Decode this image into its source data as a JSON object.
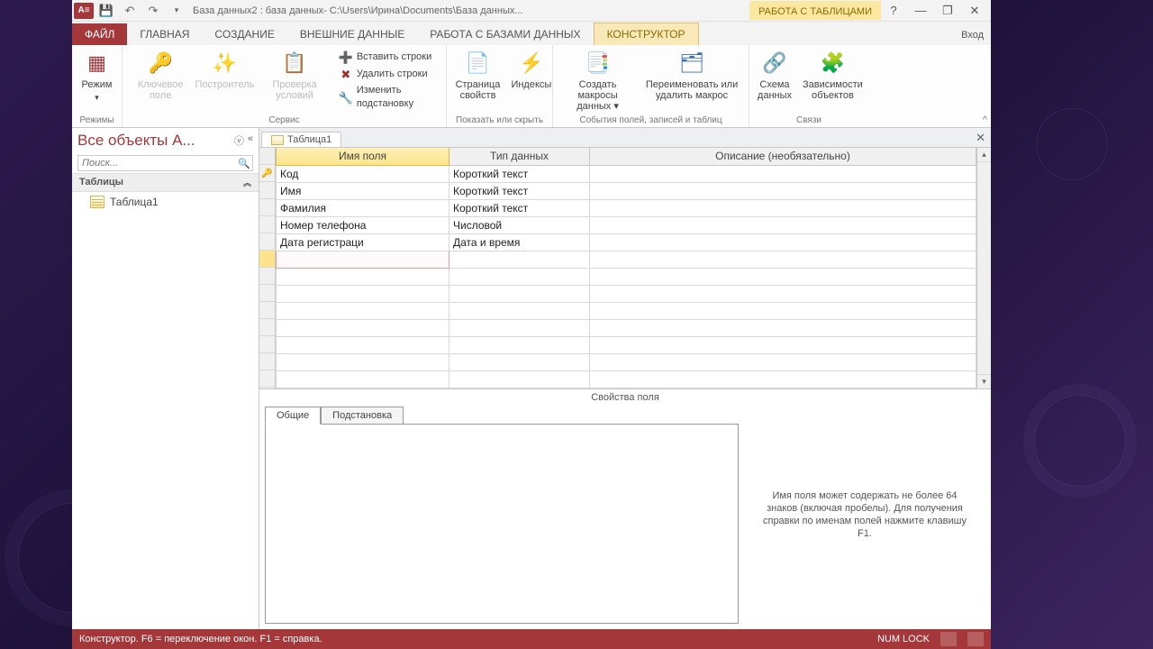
{
  "titlebar": {
    "app_icon_text": "A≡",
    "title": "База данных2 : база данных- C:\\Users\\Ирина\\Documents\\База данных...",
    "tool_tab": "РАБОТА С ТАБЛИЦАМИ"
  },
  "tabs": {
    "file": "ФАЙЛ",
    "home": "ГЛАВНАЯ",
    "create": "СОЗДАНИЕ",
    "external": "ВНЕШНИЕ ДАННЫЕ",
    "dbwork": "РАБОТА С БАЗАМИ ДАННЫХ",
    "design": "КОНСТРУКТОР",
    "login": "Вход"
  },
  "ribbon": {
    "view": "Режим",
    "keyfield": "Ключевое поле",
    "builder": "Построитель",
    "validation": "Проверка условий",
    "insert_rows": "Вставить строки",
    "delete_rows": "Удалить строки",
    "modify_lookup": "Изменить подстановку",
    "prop_sheet": "Страница свойств",
    "indexes": "Индексы",
    "create_macros": "Создать макросы данных ▾",
    "rename_macro": "Переименовать или удалить макрос",
    "rel_schema": "Схема данных",
    "obj_deps": "Зависимости объектов",
    "g_modes": "Режимы",
    "g_service": "Сервис",
    "g_showhide": "Показать или скрыть",
    "g_events": "События полей, записей и таблиц",
    "g_links": "Связи"
  },
  "nav": {
    "title": "Все объекты A...",
    "search_ph": "Поиск...",
    "category": "Таблицы",
    "item1": "Таблица1"
  },
  "doc": {
    "tab": "Таблица1"
  },
  "grid": {
    "col_name": "Имя поля",
    "col_type": "Тип данных",
    "col_desc": "Описание (необязательно)",
    "rows": [
      {
        "name": "Код",
        "type": "Короткий текст",
        "key": true
      },
      {
        "name": "Имя",
        "type": "Короткий текст",
        "key": false
      },
      {
        "name": "Фамилия",
        "type": "Короткий текст",
        "key": false
      },
      {
        "name": "Номер телефона",
        "type": "Числовой",
        "key": false
      },
      {
        "name": "Дата регистраци",
        "type": "Дата и время",
        "key": false
      }
    ]
  },
  "props": {
    "title": "Свойства поля",
    "tab_general": "Общие",
    "tab_lookup": "Подстановка",
    "help": "Имя поля может содержать не более 64 знаков (включая пробелы). Для получения справки по именам полей нажмите клавишу F1."
  },
  "status": {
    "left": "Конструктор.  F6 = переключение окон.  F1 = справка.",
    "numlock": "NUM LOCK"
  }
}
